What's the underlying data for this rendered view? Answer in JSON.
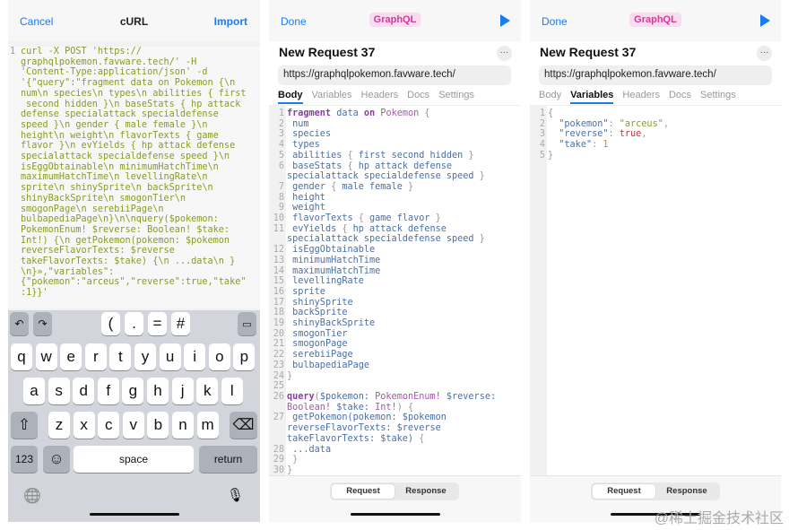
{
  "left": {
    "cancel": "Cancel",
    "title": "cURL",
    "import": "Import",
    "line_number": "1",
    "curl_lines": [
      "curl -X POST 'https://",
      "graphqlpokemon.favware.tech/' -H",
      "'Content-Type:application/json' -d",
      "'{\"query\":\"fragment data on Pokemon {\\n",
      "num\\n species\\n types\\n abilities { first",
      " second hidden }\\n baseStats { hp attack",
      "defense specialattack specialdefense",
      "speed }\\n gender { male female }\\n",
      "height\\n weight\\n flavorTexts { game",
      "flavor }\\n evYields { hp attack defense",
      "specialattack specialdefense speed }\\n",
      "isEggObtainable\\n minimumHatchTime\\n",
      "maximumHatchTime\\n levellingRate\\n",
      "sprite\\n shinySprite\\n backSprite\\n",
      "shinyBackSprite\\n smogonTier\\n",
      "smogonPage\\n serebiiPage\\n",
      "bulbapediaPage\\n}\\n\\nquery($pokemon:",
      "PokemonEnum! $reverse: Boolean! $take:",
      "Int!) {\\n getPokemon(pokemon: $pokemon",
      "reverseFlavorTexts: $reverse",
      "takeFlavorTexts: $take) {\\n ...data\\n }",
      "\\n}»,\"variables\":",
      "{\"pokemon\":\"arceus\",\"reverse\":true,\"take\"",
      ":1}}'"
    ],
    "keyboard": {
      "toolbar": [
        "(",
        ".",
        "=",
        "#"
      ],
      "row1": [
        "q",
        "w",
        "e",
        "r",
        "t",
        "y",
        "u",
        "i",
        "o",
        "p"
      ],
      "row2": [
        "a",
        "s",
        "d",
        "f",
        "g",
        "h",
        "j",
        "k",
        "l"
      ],
      "row3": [
        "z",
        "x",
        "c",
        "v",
        "b",
        "n",
        "m"
      ],
      "num": "123",
      "space": "space",
      "return": "return"
    }
  },
  "request": {
    "done": "Done",
    "badge": "GraphQL",
    "title": "New Request 37",
    "more": "···",
    "url": "https://graphqlpokemon.favware.tech/",
    "tabs": [
      "Body",
      "Variables",
      "Headers",
      "Docs",
      "Settings"
    ],
    "segments": [
      "Request",
      "Response"
    ]
  },
  "body_lines": [
    {
      "n": "1",
      "s": [
        [
          "kw",
          "fragment"
        ],
        [
          "pl",
          " data "
        ],
        [
          "kw",
          "on"
        ],
        [
          "ty",
          " Pokemon "
        ],
        [
          "pu",
          "{"
        ]
      ]
    },
    {
      "n": "2",
      "s": [
        [
          "pl",
          " num"
        ]
      ]
    },
    {
      "n": "3",
      "s": [
        [
          "pl",
          " species"
        ]
      ]
    },
    {
      "n": "4",
      "s": [
        [
          "pl",
          " types"
        ]
      ]
    },
    {
      "n": "5",
      "s": [
        [
          "pl",
          " abilities "
        ],
        [
          "pu",
          "{ "
        ],
        [
          "pl",
          "first second hidden "
        ],
        [
          "pu",
          "}"
        ]
      ]
    },
    {
      "n": "6",
      "s": [
        [
          "pl",
          " baseStats "
        ],
        [
          "pu",
          "{ "
        ],
        [
          "pl",
          "hp attack defense specialattack specialdefense speed "
        ],
        [
          "pu",
          "}"
        ]
      ]
    },
    {
      "n": "7",
      "s": [
        [
          "pl",
          " gender "
        ],
        [
          "pu",
          "{ "
        ],
        [
          "pl",
          "male female "
        ],
        [
          "pu",
          "}"
        ]
      ]
    },
    {
      "n": "8",
      "s": [
        [
          "pl",
          " height"
        ]
      ]
    },
    {
      "n": "9",
      "s": [
        [
          "pl",
          " weight"
        ]
      ]
    },
    {
      "n": "10",
      "s": [
        [
          "pl",
          " flavorTexts "
        ],
        [
          "pu",
          "{ "
        ],
        [
          "pl",
          "game flavor "
        ],
        [
          "pu",
          "}"
        ]
      ]
    },
    {
      "n": "11",
      "s": [
        [
          "pl",
          " evYields "
        ],
        [
          "pu",
          "{ "
        ],
        [
          "pl",
          "hp attack defense specialattack specialdefense speed "
        ],
        [
          "pu",
          "}"
        ]
      ]
    },
    {
      "n": "12",
      "s": [
        [
          "pl",
          " isEggObtainable"
        ]
      ]
    },
    {
      "n": "13",
      "s": [
        [
          "pl",
          " minimumHatchTime"
        ]
      ]
    },
    {
      "n": "14",
      "s": [
        [
          "pl",
          " maximumHatchTime"
        ]
      ]
    },
    {
      "n": "15",
      "s": [
        [
          "pl",
          " levellingRate"
        ]
      ]
    },
    {
      "n": "16",
      "s": [
        [
          "pl",
          " sprite"
        ]
      ]
    },
    {
      "n": "17",
      "s": [
        [
          "pl",
          " shinySprite"
        ]
      ]
    },
    {
      "n": "18",
      "s": [
        [
          "pl",
          " backSprite"
        ]
      ]
    },
    {
      "n": "19",
      "s": [
        [
          "pl",
          " shinyBackSprite"
        ]
      ]
    },
    {
      "n": "20",
      "s": [
        [
          "pl",
          " smogonTier"
        ]
      ]
    },
    {
      "n": "21",
      "s": [
        [
          "pl",
          " smogonPage"
        ]
      ]
    },
    {
      "n": "22",
      "s": [
        [
          "pl",
          " serebiiPage"
        ]
      ]
    },
    {
      "n": "23",
      "s": [
        [
          "pl",
          " bulbapediaPage"
        ]
      ]
    },
    {
      "n": "24",
      "s": [
        [
          "pu",
          "}"
        ]
      ]
    },
    {
      "n": "25",
      "s": [
        [
          "pl",
          " "
        ]
      ]
    },
    {
      "n": "26",
      "s": [
        [
          "kw",
          "query"
        ],
        [
          "pu",
          "("
        ],
        [
          "pl",
          "$pokemon: "
        ],
        [
          "ty",
          "PokemonEnum! "
        ],
        [
          "pl",
          "$reverse: "
        ],
        [
          "ty",
          "Boolean! "
        ],
        [
          "pl",
          "$take: "
        ],
        [
          "ty",
          "Int!"
        ],
        [
          "pu",
          ") {"
        ]
      ]
    },
    {
      "n": "27",
      "s": [
        [
          "pl",
          " getPokemon(pokemon: $pokemon reverseFlavorTexts: $reverse takeFlavorTexts: $take) "
        ],
        [
          "pu",
          "{"
        ]
      ]
    },
    {
      "n": "28",
      "s": [
        [
          "pl",
          " ...data"
        ]
      ]
    },
    {
      "n": "29",
      "s": [
        [
          "pu",
          " }"
        ]
      ]
    },
    {
      "n": "30",
      "s": [
        [
          "pu",
          "}"
        ]
      ]
    }
  ],
  "variables_lines": [
    {
      "n": "1",
      "s": [
        [
          "pu",
          "{"
        ]
      ]
    },
    {
      "n": "2",
      "s": [
        [
          "key2",
          "  \"pokemon\""
        ],
        [
          "pu",
          ": "
        ],
        [
          "str",
          "\"arceus\""
        ],
        [
          "pu",
          ","
        ]
      ]
    },
    {
      "n": "3",
      "s": [
        [
          "key2",
          "  \"reverse\""
        ],
        [
          "pu",
          ": "
        ],
        [
          "bool",
          "true"
        ],
        [
          "pu",
          ","
        ]
      ]
    },
    {
      "n": "4",
      "s": [
        [
          "key2",
          "  \"take\""
        ],
        [
          "pu",
          ": "
        ],
        [
          "numv",
          "1"
        ]
      ]
    },
    {
      "n": "5",
      "s": [
        [
          "pu",
          "}"
        ]
      ]
    }
  ],
  "watermark": "@稀土掘金技术社区",
  "colors": {
    "accent": "#1a7cf2",
    "badge_bg": "#f9dcef",
    "badge_text": "#d23a9b",
    "curl_text": "#8a9a22"
  }
}
